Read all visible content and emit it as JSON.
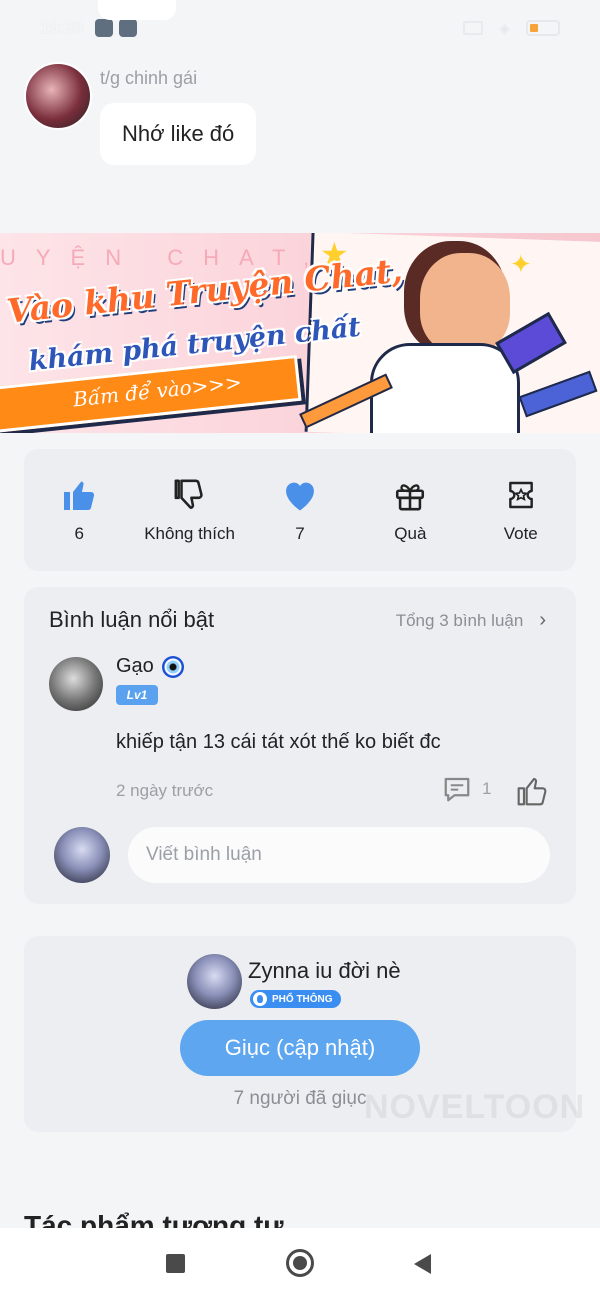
{
  "status_bar": {
    "time": "19:38"
  },
  "chat": {
    "sender_name": "t/g chinh gái",
    "message": "Nhớ like đó"
  },
  "banner": {
    "background_text": "UYỆN CHAT, KHÁM PHÁ",
    "title_line1": "Vào khu Truyện Chat,",
    "title_line2": "khám phá truyện chất",
    "cta": "Bấm để vào>>>"
  },
  "reactions": [
    {
      "icon": "thumbs-up-filled-icon",
      "label": "6",
      "color": "#4a90e8"
    },
    {
      "icon": "thumbs-down-outline-icon",
      "label": "Không thích",
      "color": "#222222"
    },
    {
      "icon": "heart-filled-icon",
      "label": "7",
      "color": "#4a90e8"
    },
    {
      "icon": "gift-icon",
      "label": "Quà",
      "color": "#222222"
    },
    {
      "icon": "vote-ticket-icon",
      "label": "Vote",
      "color": "#222222"
    }
  ],
  "comments": {
    "title": "Bình luận nổi bật",
    "total": "Tổng 3 bình luận",
    "items": [
      {
        "user": "Gạo",
        "level": "Lv1",
        "text": "khiếp tận 13 cái tát xót thế ko biết đc",
        "time": "2 ngày trước",
        "reply_count": "1"
      }
    ],
    "input_placeholder": "Viết bình luận"
  },
  "author": {
    "name": "Zynna iu đời nè",
    "tier": "PHỔ THÔNG",
    "urge_button": "Giục (cập nhật)",
    "urge_count": "7 người đã giục",
    "watermark": "NOVELTOON"
  },
  "section_heading": "Tác phẩm tương tự",
  "colors": {
    "accent": "#5ea6ef",
    "card_bg": "#eceef2",
    "page_bg": "#f4f5f7"
  }
}
